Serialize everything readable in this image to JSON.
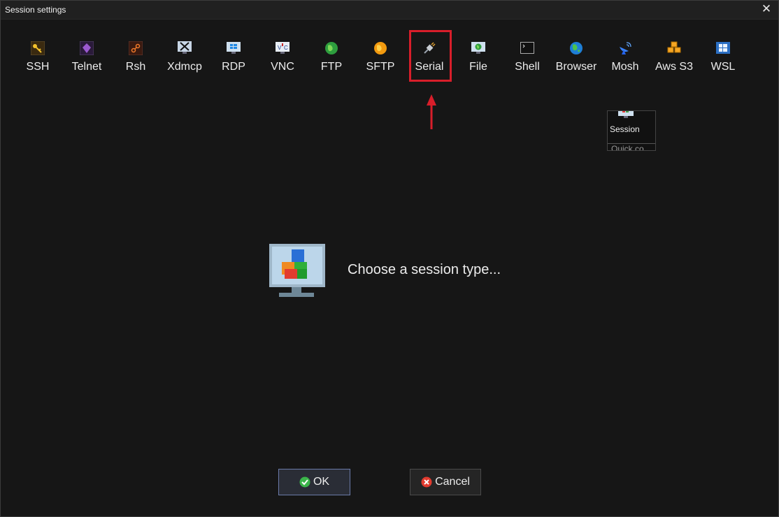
{
  "window": {
    "title": "Session settings"
  },
  "toolbar": {
    "items": [
      {
        "label": "SSH",
        "icon": "key-icon"
      },
      {
        "label": "Telnet",
        "icon": "telnet-icon"
      },
      {
        "label": "Rsh",
        "icon": "rsh-icon"
      },
      {
        "label": "Xdmcp",
        "icon": "xdmcp-icon"
      },
      {
        "label": "RDP",
        "icon": "rdp-icon"
      },
      {
        "label": "VNC",
        "icon": "vnc-icon"
      },
      {
        "label": "FTP",
        "icon": "ftp-globe-icon"
      },
      {
        "label": "SFTP",
        "icon": "sftp-globe-icon"
      },
      {
        "label": "Serial",
        "icon": "serial-plug-icon"
      },
      {
        "label": "File",
        "icon": "file-monitor-icon"
      },
      {
        "label": "Shell",
        "icon": "terminal-icon"
      },
      {
        "label": "Browser",
        "icon": "browser-globe-icon"
      },
      {
        "label": "Mosh",
        "icon": "satellite-dish-icon"
      },
      {
        "label": "Aws S3",
        "icon": "aws-s3-cubes-icon"
      },
      {
        "label": "WSL",
        "icon": "windows-logo-icon"
      }
    ]
  },
  "tooltip": {
    "label": "Session",
    "cut_text": "Quick co"
  },
  "main": {
    "prompt": "Choose a session type..."
  },
  "buttons": {
    "ok": "OK",
    "cancel": "Cancel"
  },
  "colors": {
    "highlight": "#d81e2a",
    "background": "#161616"
  }
}
